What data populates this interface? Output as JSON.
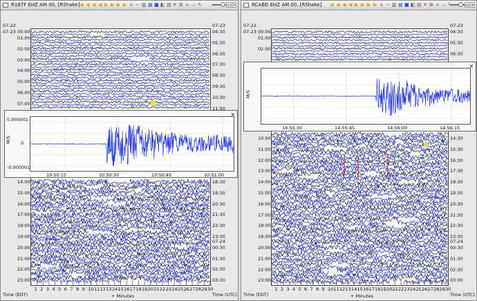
{
  "left": {
    "title": "R167F EHZ AM 00, [RShake]",
    "date_left_top": "07-22",
    "date_right_top": "07-23",
    "date_left_second": "07-23 00:00",
    "date_right_mid": "07-24",
    "hours_left_top": [
      "01:00",
      "02:00",
      "03:00",
      "04:00",
      "05:00",
      "06:00",
      "07:00"
    ],
    "hours_right_top": [
      "04:30",
      "05:30",
      "06:30",
      "07:30",
      "08:30",
      "09:30",
      "10:30",
      "11:30"
    ],
    "hours_left_bottom": [
      "14:00",
      "15:00",
      "16:00",
      "17:00",
      "18:00",
      "19:00",
      "20:00",
      "21:00",
      "22:00",
      "23:00"
    ],
    "hours_right_bottom": [
      "18:30",
      "19:30",
      "20:30",
      "21:30",
      "22:30",
      "23:30",
      "00:30",
      "01:30",
      "02:30",
      "03:30"
    ],
    "popup": {
      "ylabel": "M/S",
      "yticks": [
        "0.000001",
        "0",
        "-0.000001"
      ],
      "xticks": [
        "10:50:15",
        "10:50:30",
        "10:50:45",
        "10:51:00"
      ]
    },
    "footer_left": "Time (EDT)",
    "footer_mid": "+ Minutes",
    "footer_right": "Time (UTC)",
    "minutes": [
      "1",
      "2",
      "3",
      "4",
      "5",
      "6",
      "7",
      "8",
      "9",
      "10",
      "11",
      "12",
      "13",
      "14",
      "15",
      "16",
      "17",
      "18",
      "19",
      "20",
      "21",
      "22",
      "23",
      "24",
      "25",
      "26",
      "27",
      "28",
      "29",
      "30"
    ]
  },
  "right": {
    "title": "RCABD EHZ AM 00, [RShake]",
    "date_left_top": "07-22",
    "date_right_top": "07-23",
    "date_left_second": "07-23 00:00",
    "date_right_mid": "07-24",
    "hours_left_top": [
      "01:00",
      "02:00"
    ],
    "hours_right_top": [
      "04:30",
      "05:30",
      "06:30"
    ],
    "hours_left_bottom": [
      "10:00",
      "11:00",
      "12:00",
      "13:00",
      "14:00",
      "15:00",
      "16:00",
      "17:00",
      "18:00",
      "19:00",
      "20:00",
      "21:00",
      "22:00",
      "23:00"
    ],
    "hours_right_bottom": [
      "14:30",
      "15:30",
      "16:30",
      "17:30",
      "18:30",
      "19:30",
      "20:30",
      "21:30",
      "22:30",
      "23:30",
      "00:30",
      "01:30",
      "02:30",
      "03:30"
    ],
    "popup": {
      "ylabel": "M/S",
      "xticks": [
        "14:55:30",
        "14:55:45",
        "14:56:00",
        "14:56:15"
      ]
    },
    "footer_left": "Time (EDT)",
    "footer_mid": "+ Minutes",
    "footer_right": "Time (UTC)",
    "minutes": [
      "1",
      "2",
      "3",
      "4",
      "5",
      "6",
      "7",
      "8",
      "9",
      "10",
      "11",
      "12",
      "13",
      "14",
      "15",
      "16",
      "17",
      "18",
      "19",
      "20",
      "21",
      "22",
      "23",
      "24",
      "25",
      "26",
      "27",
      "28",
      "29",
      "30"
    ]
  },
  "colors": {
    "trace_dark": "#1a1a6e",
    "trace_blue": "#1c2fd8",
    "trace_black": "#101020",
    "popup_trace": "#2233ee",
    "pick_red": "#d01010",
    "marker_yellow": "#f0e020"
  },
  "toolbar_icons": [
    "back-icon",
    "back-icon",
    "back-icon",
    "back-icon",
    "forward-icon",
    "forward-icon",
    "forward-icon",
    "forward-icon",
    "zoom-in-icon",
    "zoom-out-icon",
    "filter-icon",
    "chart-icon",
    "color-icon",
    "split-icon",
    "stack-icon",
    "close-red-icon",
    "zoom-box-icon",
    "link-icon",
    "folder-icon",
    "pencil-icon",
    "slider-icon"
  ]
}
